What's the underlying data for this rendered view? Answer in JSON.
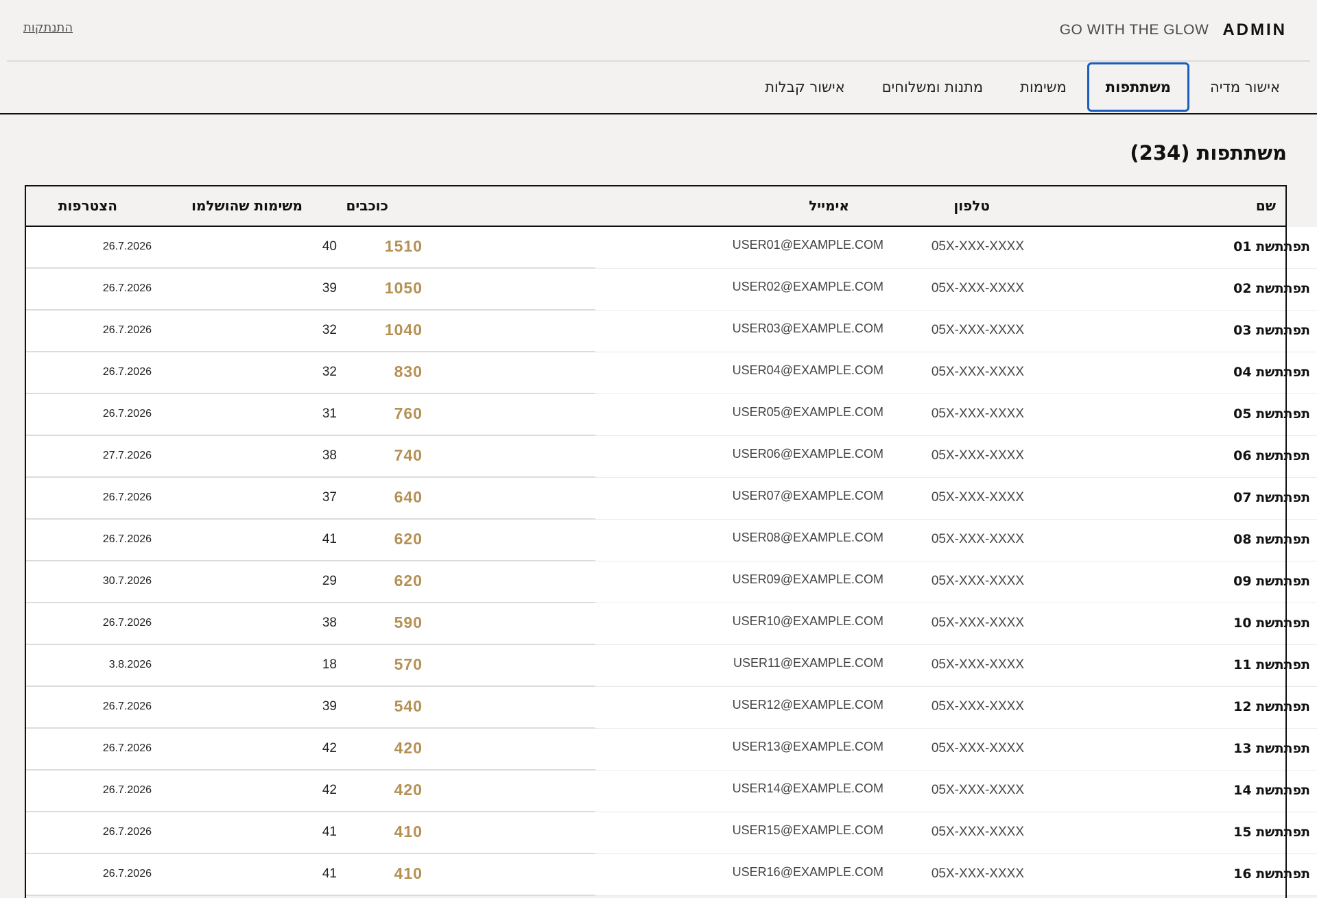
{
  "header": {
    "admin_label": "ADMIN",
    "tagline": "GO WITH THE GLOW",
    "logout_label": "התנתקות"
  },
  "tabs": [
    {
      "label": "אישור מדיה",
      "active": false
    },
    {
      "label": "משתתפות",
      "active": true
    },
    {
      "label": "משימות",
      "active": false
    },
    {
      "label": "מתנות ומשלוחים",
      "active": false
    },
    {
      "label": "אישור קבלות",
      "active": false
    }
  ],
  "page": {
    "title": "משתתפות (234)"
  },
  "table": {
    "columns": {
      "name": "שם",
      "phone": "טלפון",
      "email": "אימייל",
      "stars": "כוכבים",
      "completed": "משימות שהושלמו",
      "joined": "הצטרפות"
    },
    "rows": [
      {
        "name": "תפתתשת 01",
        "phone": "05X-XXX-XXXX",
        "email": "USER01@EXAMPLE.COM",
        "stars": "1510",
        "completed": "40",
        "joined": "26.7.2026"
      },
      {
        "name": "תפתתשת 02",
        "phone": "05X-XXX-XXXX",
        "email": "USER02@EXAMPLE.COM",
        "stars": "1050",
        "completed": "39",
        "joined": "26.7.2026"
      },
      {
        "name": "תפתתשת 03",
        "phone": "05X-XXX-XXXX",
        "email": "USER03@EXAMPLE.COM",
        "stars": "1040",
        "completed": "32",
        "joined": "26.7.2026"
      },
      {
        "name": "תפתתשת 04",
        "phone": "05X-XXX-XXXX",
        "email": "USER04@EXAMPLE.COM",
        "stars": "830",
        "completed": "32",
        "joined": "26.7.2026"
      },
      {
        "name": "תפתתשת 05",
        "phone": "05X-XXX-XXXX",
        "email": "USER05@EXAMPLE.COM",
        "stars": "760",
        "completed": "31",
        "joined": "26.7.2026"
      },
      {
        "name": "תפתתשת 06",
        "phone": "05X-XXX-XXXX",
        "email": "USER06@EXAMPLE.COM",
        "stars": "740",
        "completed": "38",
        "joined": "27.7.2026"
      },
      {
        "name": "תפתתשת 07",
        "phone": "05X-XXX-XXXX",
        "email": "USER07@EXAMPLE.COM",
        "stars": "640",
        "completed": "37",
        "joined": "26.7.2026"
      },
      {
        "name": "תפתתשת 08",
        "phone": "05X-XXX-XXXX",
        "email": "USER08@EXAMPLE.COM",
        "stars": "620",
        "completed": "41",
        "joined": "26.7.2026"
      },
      {
        "name": "תפתתשת 09",
        "phone": "05X-XXX-XXXX",
        "email": "USER09@EXAMPLE.COM",
        "stars": "620",
        "completed": "29",
        "joined": "30.7.2026"
      },
      {
        "name": "תפתתשת 10",
        "phone": "05X-XXX-XXXX",
        "email": "USER10@EXAMPLE.COM",
        "stars": "590",
        "completed": "38",
        "joined": "26.7.2026"
      },
      {
        "name": "תפתתשת 11",
        "phone": "05X-XXX-XXXX",
        "email": "USER11@EXAMPLE.COM",
        "stars": "570",
        "completed": "18",
        "joined": "3.8.2026"
      },
      {
        "name": "תפתתשת 12",
        "phone": "05X-XXX-XXXX",
        "email": "USER12@EXAMPLE.COM",
        "stars": "540",
        "completed": "39",
        "joined": "26.7.2026"
      },
      {
        "name": "תפתתשת 13",
        "phone": "05X-XXX-XXXX",
        "email": "USER13@EXAMPLE.COM",
        "stars": "420",
        "completed": "42",
        "joined": "26.7.2026"
      },
      {
        "name": "תפתתשת 14",
        "phone": "05X-XXX-XXXX",
        "email": "USER14@EXAMPLE.COM",
        "stars": "420",
        "completed": "42",
        "joined": "26.7.2026"
      },
      {
        "name": "תפתתשת 15",
        "phone": "05X-XXX-XXXX",
        "email": "USER15@EXAMPLE.COM",
        "stars": "410",
        "completed": "41",
        "joined": "26.7.2026"
      },
      {
        "name": "תפתתשת 16",
        "phone": "05X-XXX-XXXX",
        "email": "USER16@EXAMPLE.COM",
        "stars": "410",
        "completed": "41",
        "joined": "26.7.2026"
      }
    ]
  },
  "colors": {
    "stars": "#b49055",
    "active_tab_border": "#1a5cbf",
    "background": "#f3f2f0"
  }
}
